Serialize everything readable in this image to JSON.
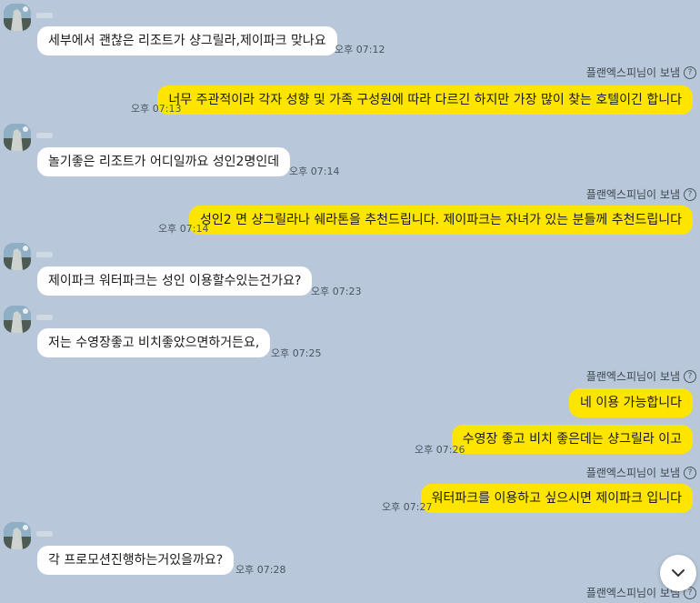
{
  "sender_label": "플랜엑스피님이 보냄",
  "help_glyph": "?",
  "messages": [
    {
      "text": "세부에서 괜찮은 리조트가 샹그릴라,제이파크 맞나요",
      "time": "오후 07:12"
    },
    {
      "text": "너무 주관적이라 각자 성향 및 가족 구성원에 따라 다르긴 하지만 가장 많이 찾는 호텔이긴 합니다",
      "time": "오후 07:13"
    },
    {
      "text": "놀기좋은 리조트가 어디일까요 성인2명인데",
      "time": "오후 07:14"
    },
    {
      "text": "성인2 면 샹그릴라나 쉐라톤을 추천드립니다. 제이파크는 자녀가 있는 분들께 추천드립니다",
      "time": "오후 07:14"
    },
    {
      "text": "제이파크 워터파크는 성인 이용할수있는건가요?",
      "time": "오후 07:23"
    },
    {
      "text": "저는 수영장좋고 비치좋았으면하거든요,",
      "time": "오후 07:25"
    },
    {
      "text": "네 이용 가능합니다",
      "time": ""
    },
    {
      "text": "수영장 좋고 비치 좋은데는 샹그릴라 이고",
      "time": "오후 07:26"
    },
    {
      "text": "워터파크를 이용하고 싶으시면 제이파크 입니다",
      "time": "오후 07:27"
    },
    {
      "text": "각 프로모션진행하는거있을까요?",
      "time": "오후 07:28"
    }
  ]
}
